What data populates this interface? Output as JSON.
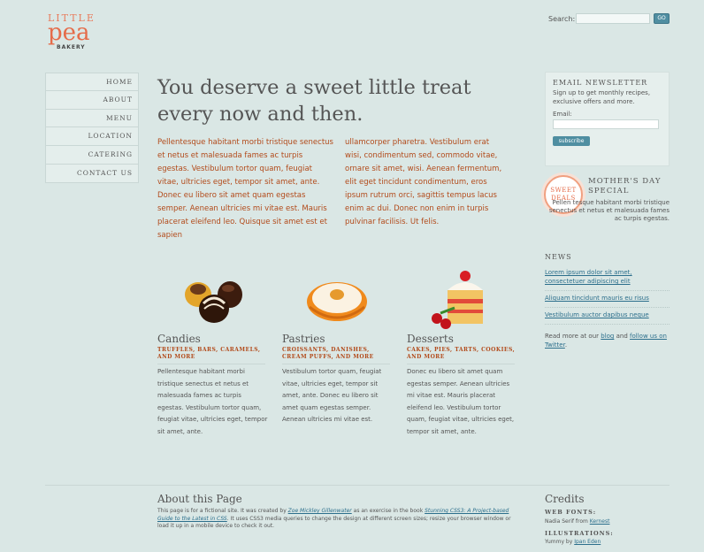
{
  "logo": {
    "little": "LITTLE",
    "pea": "pea",
    "bakery": "BAKERY"
  },
  "search": {
    "label": "Search:",
    "button": "GO",
    "placeholder": ""
  },
  "nav": {
    "items": [
      "HOME",
      "ABOUT",
      "MENU",
      "LOCATION",
      "CATERING",
      "CONTACT US"
    ]
  },
  "hero": {
    "line1": "You deserve a sweet little treat",
    "line2": "every now and then."
  },
  "intro": {
    "col1": "Pellentesque habitant morbi tristique senectus et netus et malesuada fames ac turpis egestas. Vestibulum tortor quam, feugiat vitae, ultricies eget, tempor sit amet, ante. Donec eu libero sit amet quam egestas semper. Aenean ultricies mi vitae est. Mauris placerat eleifend leo. Quisque sit amet est et sapien",
    "col2": "ullamcorper pharetra. Vestibulum erat wisi, condimentum sed, commodo vitae, ornare sit amet, wisi. Aenean fermentum, elit eget tincidunt condimentum, eros ipsum rutrum orci, sagittis tempus lacus enim ac dui. Donec non enim in turpis pulvinar facilisis. Ut felis."
  },
  "foods": [
    {
      "title": "Candies",
      "sub": "TRUFFLES, BARS, CARAMELS, AND MORE",
      "text": "Pellentesque habitant morbi tristique senectus et netus et malesuada fames ac turpis egestas. Vestibulum tortor quam, feugiat vitae, ultricies eget, tempor sit amet, ante."
    },
    {
      "title": "Pastries",
      "sub": "CROISSANTS, DANISHES, CREAM PUFFS, AND MORE",
      "text": "Vestibulum tortor quam, feugiat vitae, ultricies eget, tempor sit amet, ante. Donec eu libero sit amet quam egestas semper. Aenean ultricies mi vitae est."
    },
    {
      "title": "Desserts",
      "sub": "CAKES, PIES, TARTS, COOKIES, AND MORE",
      "text": "Donec eu libero sit amet quam egestas semper. Aenean ultricies mi vitae est. Mauris placerat eleifend leo. Vestibulum tortor quam, feugiat vitae, ultricies eget, tempor sit amet, ante."
    }
  ],
  "newsletter": {
    "title": "EMAIL NEWSLETTER",
    "text": "Sign up to get monthly recipes, exclusive offers and more.",
    "email_label": "Email:",
    "button": "subscribe"
  },
  "special": {
    "badge_line1": "SWEET",
    "badge_line2": "DEALS",
    "title_line1": "MOTHER'S DAY",
    "title_line2": "SPECIAL",
    "text": "Pellen tesque habitant morbi tristique senectus et netus et malesuada fames ac turpis egestas."
  },
  "news": {
    "title": "NEWS",
    "links": [
      "Lorem ipsum dolor sit amet, consectetuer adipiscing elit",
      "Aliquam tincidunt mauris eu risus",
      "Vestibulum auctor dapibus neque"
    ],
    "more_pre": "Read more at our",
    "blog": "blog",
    "and": "and",
    "follow": "follow us on Twitter",
    "period": "."
  },
  "about": {
    "title": "About this Page",
    "p1": "This page is for a fictional site. It was created by",
    "author": "Zoe Mickley Gillenwater",
    "p2": "as an exercise in the book",
    "book": "Stunning CSS3: A Project-based Guide to the Latest in CSS",
    "p3": ". It uses CSS3 media queries to change the design at different screen sizes; resize your browser window or load it up in a mobile device to check it out."
  },
  "credits": {
    "title": "Credits",
    "fonts_h": "WEB FONTS:",
    "fonts_t": "Nadia Serif from",
    "fonts_link": "Kernest",
    "illus_h": "ILLUSTRATIONS:",
    "illus_t": "Yummy by",
    "illus_link": "Ipan Eden"
  },
  "colors": {
    "accent": "#e56c4a",
    "link": "#2c6f8c",
    "button": "#4f8ea1",
    "background": "#dae7e5"
  }
}
